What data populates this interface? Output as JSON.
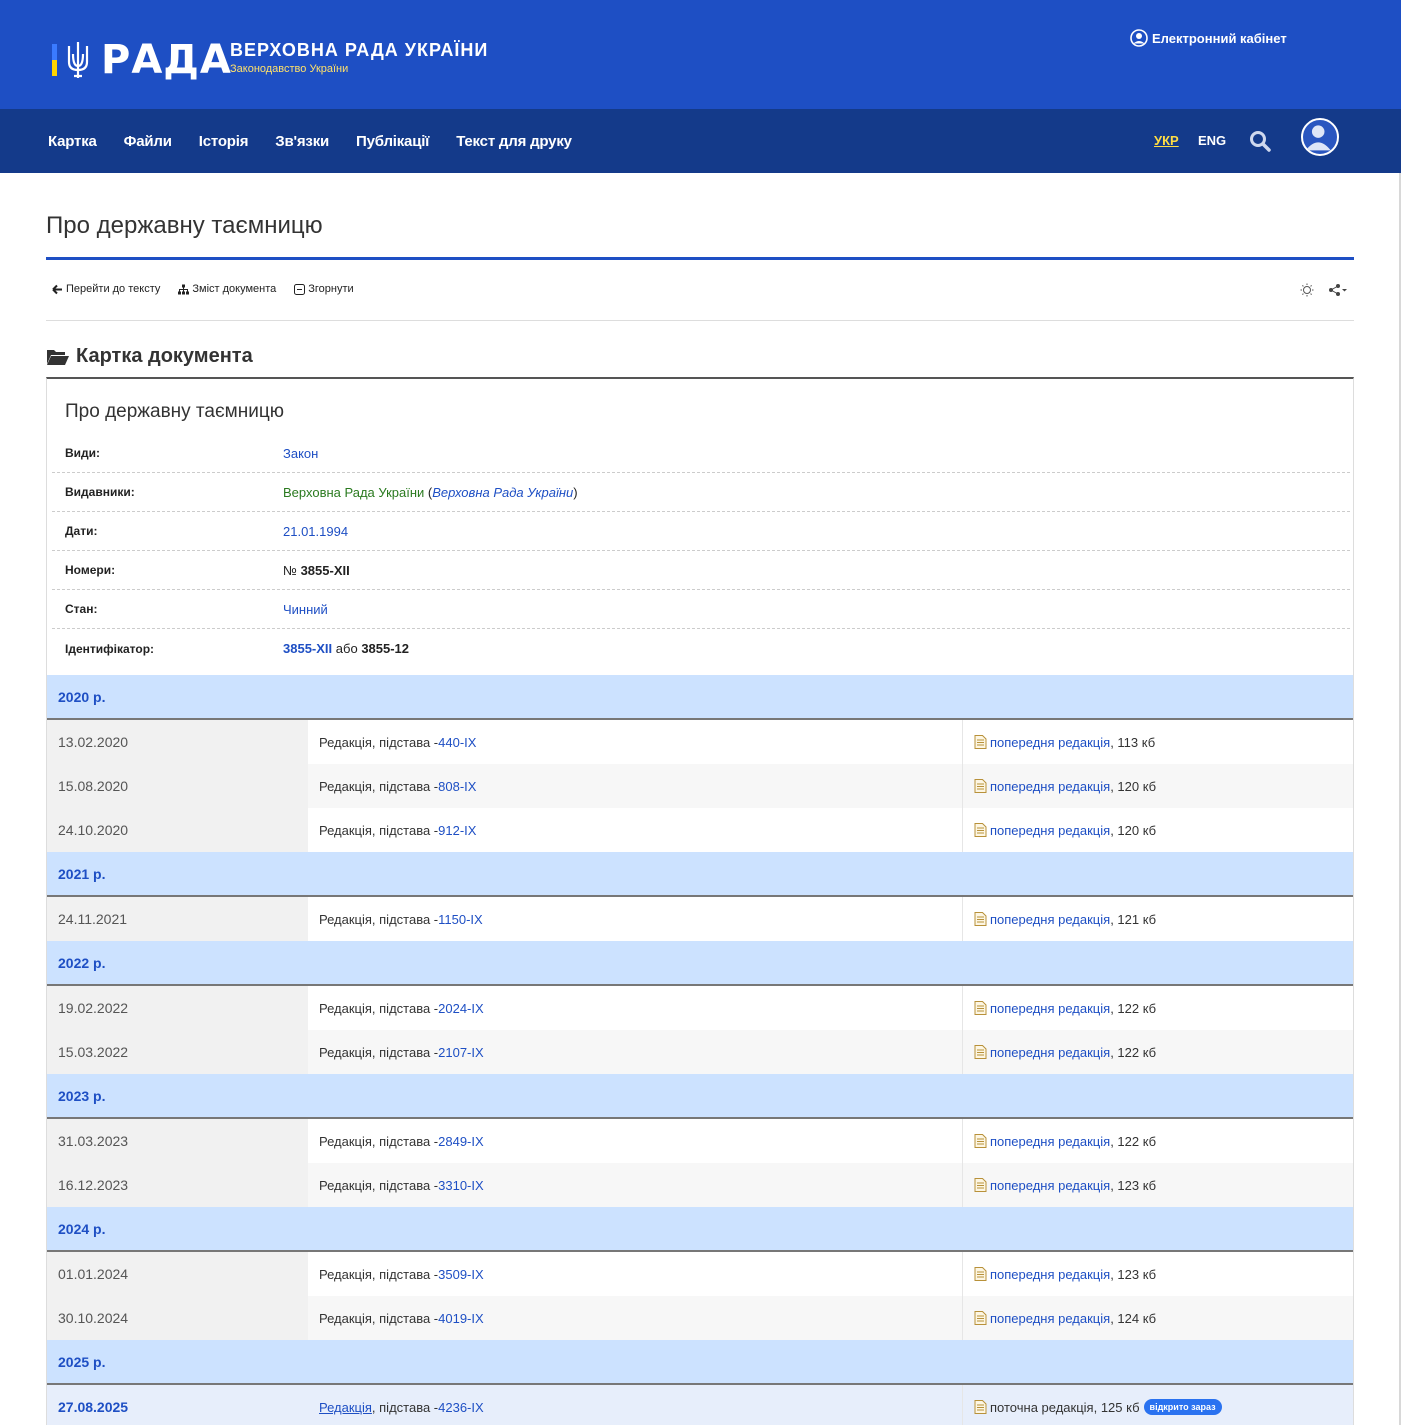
{
  "header": {
    "logo_word": "РАДА",
    "title": "ВЕРХОВНА РАДА УКРАЇНИ",
    "subtitle": "Законодавство України",
    "cabinet": "Електронний кабінет",
    "colors": {
      "primary": "#1e4fc4",
      "nav": "#143a8a",
      "accent": "#ffdd44"
    }
  },
  "nav": {
    "items": [
      "Картка",
      "Файли",
      "Історія",
      "Зв'язки",
      "Публікації",
      "Текст для друку"
    ],
    "lang_active": "УКР",
    "lang_other": "ENG"
  },
  "page": {
    "title": "Про державну таємницю"
  },
  "toolbar": {
    "goto_text": "Перейти до тексту",
    "contents": "Зміст документа",
    "collapse": "Згорнути"
  },
  "section": {
    "title": "Картка документа"
  },
  "card": {
    "doc_title": "Про державну таємницю",
    "props": {
      "types_label": "Види:",
      "types_value": "Закон",
      "publishers_label": "Видавники:",
      "publishers_value": "Верховна Рада України",
      "publishers_paren": "Верховна Рада України",
      "dates_label": "Дати:",
      "dates_value": "21.01.1994",
      "numbers_label": "Номери:",
      "numbers_prefix": "№",
      "numbers_value": "3855-XII",
      "status_label": "Стан:",
      "status_value": "Чинний",
      "id_label": "Ідентифікатор:",
      "id_value": "3855-XII",
      "id_or": "або",
      "id_alt": "3855-12"
    }
  },
  "editions": {
    "basis_prefix": "Редакція, підстава - ",
    "basis_word": "Редакція",
    "basis_rest": ", підстава - ",
    "prev_label": "попередня редакція",
    "current_label": "поточна редакція",
    "open_now": "відкрито зараз",
    "years": [
      {
        "year": "2020 р.",
        "rows": [
          {
            "date": "13.02.2020",
            "basis": "440-IX",
            "size": ", 113 кб"
          },
          {
            "date": "15.08.2020",
            "basis": "808-IX",
            "size": ", 120 кб"
          },
          {
            "date": "24.10.2020",
            "basis": "912-IX",
            "size": ", 120 кб"
          }
        ]
      },
      {
        "year": "2021 р.",
        "rows": [
          {
            "date": "24.11.2021",
            "basis": "1150-IX",
            "size": ", 121 кб"
          }
        ]
      },
      {
        "year": "2022 р.",
        "rows": [
          {
            "date": "19.02.2022",
            "basis": "2024-IX",
            "size": ", 122 кб"
          },
          {
            "date": "15.03.2022",
            "basis": "2107-IX",
            "size": ", 122 кб"
          }
        ]
      },
      {
        "year": "2023 р.",
        "rows": [
          {
            "date": "31.03.2023",
            "basis": "2849-IX",
            "size": ", 122 кб"
          },
          {
            "date": "16.12.2023",
            "basis": "3310-IX",
            "size": ", 123 кб"
          }
        ]
      },
      {
        "year": "2024 р.",
        "rows": [
          {
            "date": "01.01.2024",
            "basis": "3509-IX",
            "size": ", 123 кб"
          },
          {
            "date": "30.10.2024",
            "basis": "4019-IX",
            "size": ", 124 кб"
          }
        ]
      },
      {
        "year": "2025 р.",
        "rows": [
          {
            "date": "27.08.2025",
            "basis": "4236-IX",
            "size": ", 125 кб",
            "current": true
          }
        ]
      }
    ]
  }
}
